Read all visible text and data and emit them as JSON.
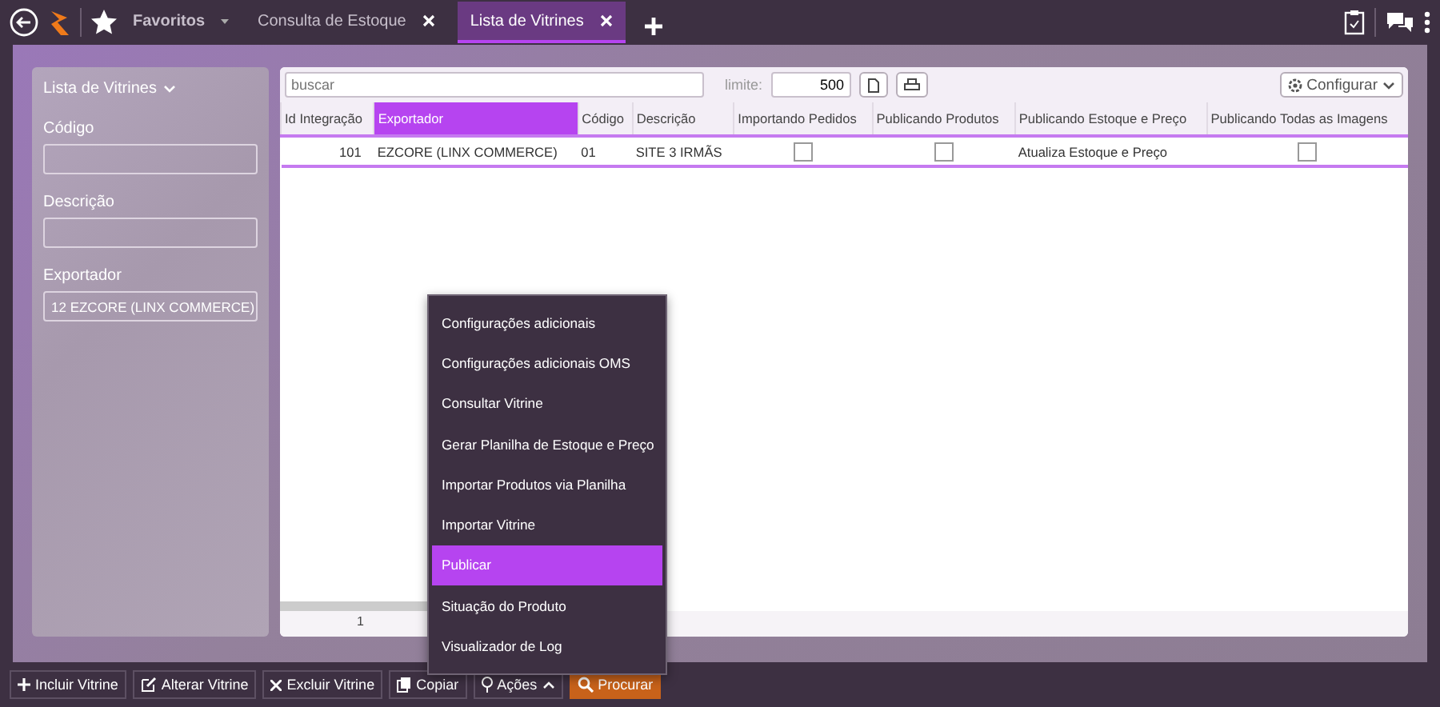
{
  "top_bar": {
    "favorites": "Favoritos",
    "tabs": [
      {
        "label": "Consulta de Estoque",
        "selected": false
      },
      {
        "label": "Lista de Vitrines",
        "selected": true
      }
    ]
  },
  "filter_panel": {
    "title": "Lista de Vitrines",
    "fields": [
      {
        "label": "Código",
        "kind": "input"
      },
      {
        "label": "Descrição",
        "kind": "input"
      },
      {
        "label": "Exportador",
        "kind": "select",
        "value": "12 EZCORE (LINX COMMERCE)"
      }
    ]
  },
  "toolbar": {
    "search": {
      "placeholder": "buscar"
    },
    "limit_label": "limite:",
    "limit": "500",
    "configure": "Configurar"
  },
  "table": {
    "columns": [
      {
        "label": "Id Integração",
        "selected": false
      },
      {
        "label": "Exportador",
        "selected": true
      },
      {
        "label": "Código",
        "selected": false
      },
      {
        "label": "Descrição",
        "selected": false
      },
      {
        "label": "Importando Pedidos",
        "selected": false
      },
      {
        "label": "Publicando Produtos",
        "selected": false
      },
      {
        "label": "Publicando Estoque e Preço",
        "selected": false
      },
      {
        "label": "Publicando Todas as Imagens",
        "selected": false
      }
    ],
    "rows": [
      {
        "selected": true,
        "cells": [
          {
            "kind": "number",
            "text": "101"
          },
          {
            "kind": "text",
            "text": "EZCORE (LINX COMMERCE)"
          },
          {
            "kind": "text",
            "text": "01"
          },
          {
            "kind": "text",
            "text": "SITE 3 IRMÃS"
          },
          {
            "kind": "checkbox",
            "checked": false
          },
          {
            "kind": "checkbox",
            "checked": false
          },
          {
            "kind": "text",
            "text": "Atualiza Estoque e Preço"
          },
          {
            "kind": "checkbox",
            "checked": false
          }
        ]
      }
    ],
    "page": "1"
  },
  "actions_menu": [
    {
      "label": "Configurações adicionais",
      "selected": false
    },
    {
      "label": "Configurações adicionais OMS",
      "selected": false
    },
    {
      "label": "Consultar Vitrine",
      "selected": false
    },
    {
      "label": "Gerar Planilha de Estoque e Preço",
      "selected": false
    },
    {
      "label": "Importar Produtos via Planilha",
      "selected": false
    },
    {
      "label": "Importar Vitrine",
      "selected": false
    },
    {
      "label": "Publicar",
      "selected": true
    },
    {
      "label": "Situação do Produto",
      "selected": false
    },
    {
      "label": "Visualizador de Log",
      "selected": false
    }
  ],
  "bottom_buttons": [
    {
      "label": "Incluir Vitrine",
      "kind": "add"
    },
    {
      "label": "Alterar Vitrine",
      "kind": "edit"
    },
    {
      "label": "Excluir Vitrine",
      "kind": "delete"
    },
    {
      "label": "Copiar",
      "kind": "copy"
    },
    {
      "label": "Ações",
      "kind": "actions"
    },
    {
      "label": "Procurar",
      "kind": "search"
    }
  ]
}
